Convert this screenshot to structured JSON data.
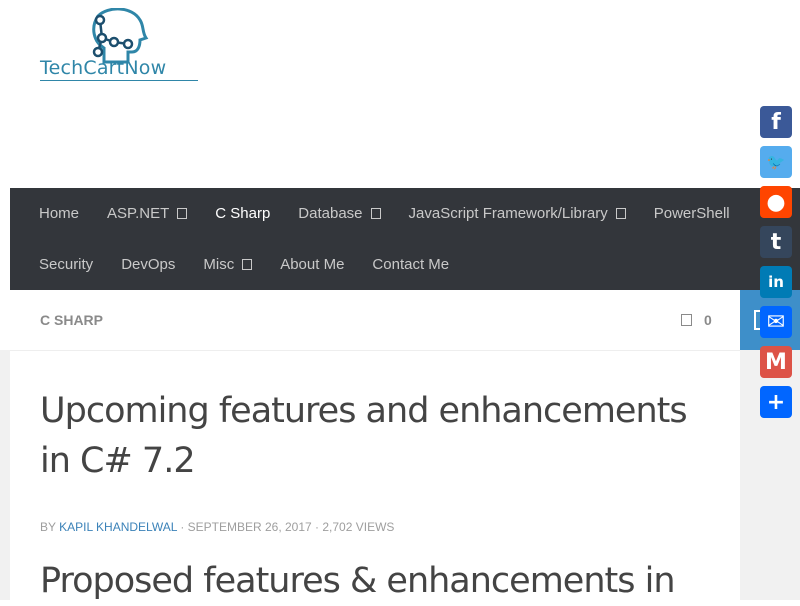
{
  "logo": {
    "text": "TechCartNow"
  },
  "nav": {
    "row1": [
      {
        "label": "Home",
        "dropdown": false,
        "active": false
      },
      {
        "label": "ASP.NET",
        "dropdown": true,
        "active": false
      },
      {
        "label": "C Sharp",
        "dropdown": false,
        "active": true
      },
      {
        "label": "Database",
        "dropdown": true,
        "active": false
      },
      {
        "label": "JavaScript Framework/Library",
        "dropdown": true,
        "active": false
      },
      {
        "label": "PowerShell",
        "dropdown": false,
        "active": false
      }
    ],
    "row2": [
      {
        "label": "Security",
        "dropdown": false,
        "active": false
      },
      {
        "label": "DevOps",
        "dropdown": false,
        "active": false
      },
      {
        "label": "Misc",
        "dropdown": true,
        "active": false
      },
      {
        "label": "About Me",
        "dropdown": false,
        "active": false
      },
      {
        "label": "Contact Me",
        "dropdown": false,
        "active": false
      }
    ]
  },
  "category": {
    "label": "C SHARP",
    "comment_count": "0"
  },
  "post": {
    "title": "Upcoming features and enhancements in C# 7.2",
    "by": "BY",
    "author": "KAPIL KHANDELWAL",
    "date": "· SEPTEMBER 26, 2017",
    "views": "· 2,702 VIEWS",
    "subheading": "Proposed features & enhancements in"
  },
  "share": [
    {
      "name": "Facebook",
      "icon": "facebook-icon",
      "color": "#3b5998",
      "glyph": "f"
    },
    {
      "name": "Twitter",
      "icon": "twitter-icon",
      "color": "#55acee",
      "glyph": "🐦"
    },
    {
      "name": "Reddit",
      "icon": "reddit-icon",
      "color": "#ff4500",
      "glyph": "●"
    },
    {
      "name": "Tumblr",
      "icon": "tumblr-icon",
      "color": "#35465c",
      "glyph": "t"
    },
    {
      "name": "LinkedIn",
      "icon": "linkedin-icon",
      "color": "#007bb5",
      "glyph": "in"
    },
    {
      "name": "Email",
      "icon": "email-icon",
      "color": "#0166ff",
      "glyph": "✉"
    },
    {
      "name": "Gmail",
      "icon": "gmail-icon",
      "color": "#dd5347",
      "glyph": "M"
    },
    {
      "name": "Share",
      "icon": "share-icon",
      "color": "#0166ff",
      "glyph": "+"
    }
  ],
  "colors": {
    "nav_bg": "#33363b",
    "accent": "#3e8fc9",
    "link": "#3b82b8",
    "text": "#444444"
  }
}
